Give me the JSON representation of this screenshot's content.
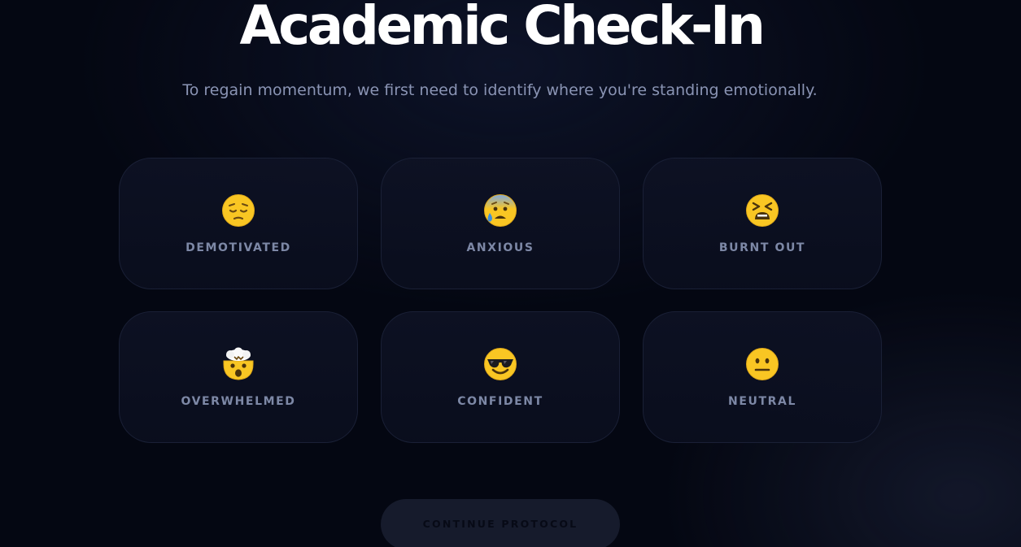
{
  "header": {
    "title": "Academic Check-In",
    "subtitle": "To regain momentum, we first need to identify where you're standing emotionally."
  },
  "moods": [
    {
      "label": "DEMOTIVATED",
      "icon": "pensive-face-icon"
    },
    {
      "label": "ANXIOUS",
      "icon": "anxious-face-with-sweat-icon"
    },
    {
      "label": "BURNT OUT",
      "icon": "tired-face-icon"
    },
    {
      "label": "OVERWHELMED",
      "icon": "exploding-head-icon"
    },
    {
      "label": "CONFIDENT",
      "icon": "smiling-face-with-sunglasses-icon"
    },
    {
      "label": "NEUTRAL",
      "icon": "neutral-face-icon"
    }
  ],
  "actions": {
    "continue_label": "CONTINUE PROTOCOL"
  },
  "colors": {
    "background": "#040712",
    "card_background": "#0c1022",
    "card_border": "#1a2036",
    "label": "#7d88a6",
    "subtitle": "#8a94b4",
    "emoji_yellow": "#f9c623",
    "button_background": "#161b2c"
  }
}
